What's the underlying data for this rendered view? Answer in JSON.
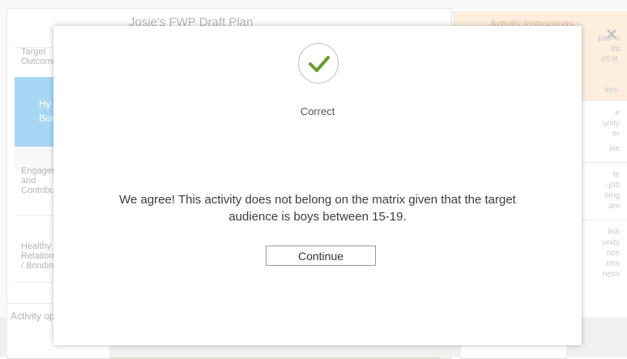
{
  "background": {
    "matrix_title": "Josie's FWP Draft Plan",
    "row_labels": [
      "Target Outcome",
      "Engagement and Contribution",
      "Healthy Relationships / Bonding",
      "Activity options do not"
    ],
    "blue_cell_text": "Hy\nBon",
    "sidebar": {
      "title": "Activity Instructions",
      "header_lines": [
        "ptions",
        "thi",
        "n't lit,",
        "ires."
      ],
      "fragments": [
        "e",
        "unity",
        "er",
        "ive",
        "te",
        "-job",
        "ning",
        "am",
        "lish",
        "unity",
        "nce",
        "rms",
        "ness"
      ]
    }
  },
  "modal": {
    "status": "Correct",
    "message": "We agree! This activity does not belong on the matrix given that the target audience is boys between 15-19.",
    "continue_label": "Continue"
  },
  "colors": {
    "check_green": "#6b9a2f",
    "sidebar_header": "#fbe1c4",
    "blue_cell": "#5fb7e9"
  },
  "icons": {
    "status": "checkmark-icon",
    "sidebar_close": "close-icon"
  }
}
